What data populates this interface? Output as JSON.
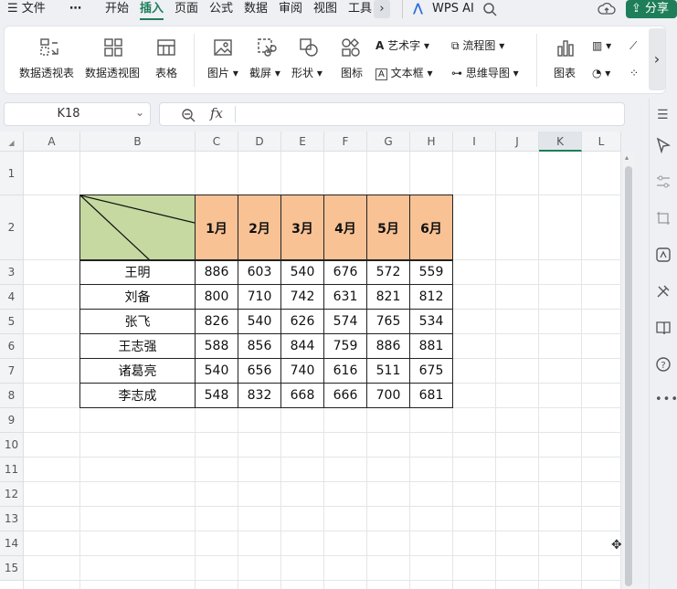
{
  "menu": {
    "file": "文件",
    "more": "⋯",
    "tabs": [
      "开始",
      "插入",
      "页面",
      "公式",
      "数据",
      "审阅",
      "视图",
      "工具"
    ],
    "active_tab": "插入",
    "wps_ai": "WPS AI",
    "share": "分享"
  },
  "ribbon": {
    "pivot_table": "数据透视表",
    "pivot_chart": "数据透视图",
    "table": "表格",
    "picture": "图片",
    "screenshot": "截屏",
    "shape": "形状",
    "icon": "图标",
    "wordart": "艺术字",
    "textbox": "文本框",
    "flowchart": "流程图",
    "mindmap": "思维导图",
    "chart": "图表"
  },
  "formula_bar": {
    "name_box": "K18",
    "fx": "fx",
    "formula": ""
  },
  "sheet": {
    "columns": [
      "A",
      "B",
      "C",
      "D",
      "E",
      "F",
      "G",
      "H",
      "I",
      "J",
      "K",
      "L"
    ],
    "rows": [
      "1",
      "2",
      "3",
      "4",
      "5",
      "6",
      "7",
      "8",
      "9",
      "10",
      "11",
      "12",
      "13",
      "14",
      "15"
    ],
    "selected_col": "K",
    "months": [
      "1月",
      "2月",
      "3月",
      "4月",
      "5月",
      "6月"
    ],
    "people": [
      {
        "name": "王明",
        "values": [
          "886",
          "603",
          "540",
          "676",
          "572",
          "559"
        ]
      },
      {
        "name": "刘备",
        "values": [
          "800",
          "710",
          "742",
          "631",
          "821",
          "812"
        ]
      },
      {
        "name": "张飞",
        "values": [
          "826",
          "540",
          "626",
          "574",
          "765",
          "534"
        ]
      },
      {
        "name": "王志强",
        "values": [
          "588",
          "856",
          "844",
          "759",
          "886",
          "881"
        ]
      },
      {
        "name": "诸葛亮",
        "values": [
          "540",
          "656",
          "740",
          "616",
          "511",
          "675"
        ]
      },
      {
        "name": "李志成",
        "values": [
          "548",
          "832",
          "668",
          "666",
          "700",
          "681"
        ]
      }
    ]
  },
  "colors": {
    "accent": "#1e7e5a",
    "header_fill": "#f8c295",
    "diag_fill": "#c5d9a0"
  }
}
